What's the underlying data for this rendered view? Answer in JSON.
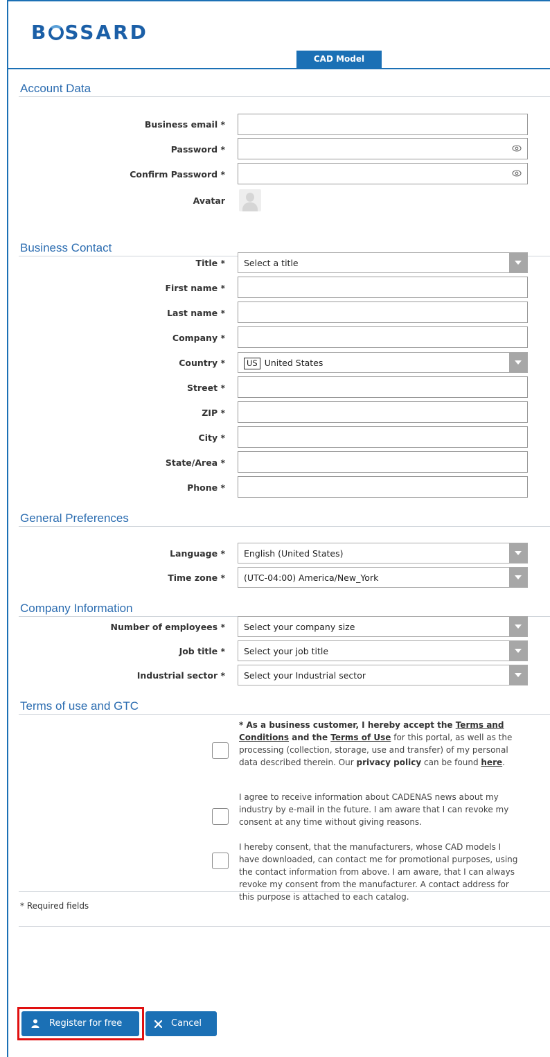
{
  "brand": {
    "logo_prefix": "B",
    "logo_suffix": "SSARD"
  },
  "tab": {
    "label": "CAD Model"
  },
  "sections": {
    "account": "Account Data",
    "business": "Business Contact",
    "preferences": "General Preferences",
    "company": "Company Information",
    "terms": "Terms of use and GTC"
  },
  "account": {
    "email_label": "Business email *",
    "password_label": "Password *",
    "confirm_label": "Confirm Password *",
    "avatar_label": "Avatar"
  },
  "business": {
    "title_label": "Title *",
    "title_value": "Select a title",
    "first_label": "First name *",
    "last_label": "Last name *",
    "company_label": "Company *",
    "country_label": "Country *",
    "country_code": "US",
    "country_value": "United States",
    "street_label": "Street *",
    "zip_label": "ZIP *",
    "city_label": "City *",
    "state_label": "State/Area *",
    "phone_label": "Phone *"
  },
  "preferences": {
    "language_label": "Language *",
    "language_value": "English (United States)",
    "timezone_label": "Time zone *",
    "timezone_value": "(UTC-04:00) America/New_York"
  },
  "company": {
    "employees_label": "Number of employees *",
    "employees_value": "Select your company size",
    "job_label": "Job title *",
    "job_value": "Select your job title",
    "sector_label": "Industrial sector *",
    "sector_value": "Select your Industrial sector"
  },
  "terms": {
    "t1_a": "* As a business customer, I hereby accept the ",
    "t1_link1": "Terms and Conditions",
    "t1_b": " and the ",
    "t1_link2": "Terms of Use",
    "t1_c": " for this portal, as well as the processing (collection, storage, use and transfer) of my personal data described therein. Our ",
    "t1_privacy": "privacy policy",
    "t1_d": " can be found ",
    "t1_here": "here",
    "t1_e": ".",
    "t2": "I agree to receive information about CADENAS news about my industry by e-mail in the future. I am aware that I can revoke my consent at any time without giving reasons.",
    "t3": "I hereby consent, that the manufacturers, whose CAD models I have downloaded, can contact me for promotional purposes, using the contact information from above. I am aware, that I can always revoke my consent from the manufacturer. A contact address for this purpose is attached to each catalog."
  },
  "footer": {
    "required_note": "* Required fields",
    "register_label": "Register for free",
    "cancel_label": "Cancel"
  }
}
